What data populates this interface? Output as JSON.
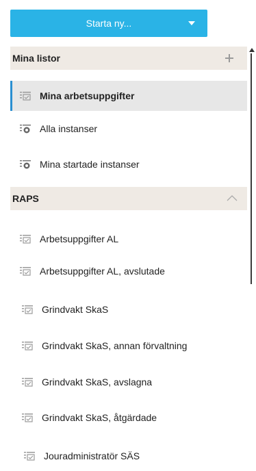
{
  "start_button": {
    "label": "Starta ny..."
  },
  "my_lists": {
    "title": "Mina listor",
    "items": [
      {
        "label": "Mina arbetsuppgifter",
        "icon": "task-list-icon",
        "active": true
      },
      {
        "label": "Alla instanser",
        "icon": "instance-list-icon"
      },
      {
        "label": "Mina startade instanser",
        "icon": "instance-list-icon"
      }
    ]
  },
  "raps": {
    "title": "RAPS",
    "items": [
      {
        "label": "Arbetsuppgifter AL",
        "icon": "task-list-icon"
      },
      {
        "label": "Arbetsuppgifter AL, avslutade",
        "icon": "task-list-icon"
      },
      {
        "label": "Grindvakt SkaS",
        "icon": "task-list-icon"
      },
      {
        "label": "Grindvakt SkaS, annan förvaltning",
        "icon": "task-list-icon"
      },
      {
        "label": "Grindvakt SkaS, avslagna",
        "icon": "task-list-icon"
      },
      {
        "label": "Grindvakt SkaS, åtgärdade",
        "icon": "task-list-icon"
      },
      {
        "label": "Jouradministratör SÄS",
        "icon": "task-list-icon"
      }
    ]
  },
  "colors": {
    "accent": "#2ab3e6",
    "active_marker": "#2a8fd1",
    "header_bg": "#efeae4",
    "active_bg": "#e7e7e7"
  }
}
